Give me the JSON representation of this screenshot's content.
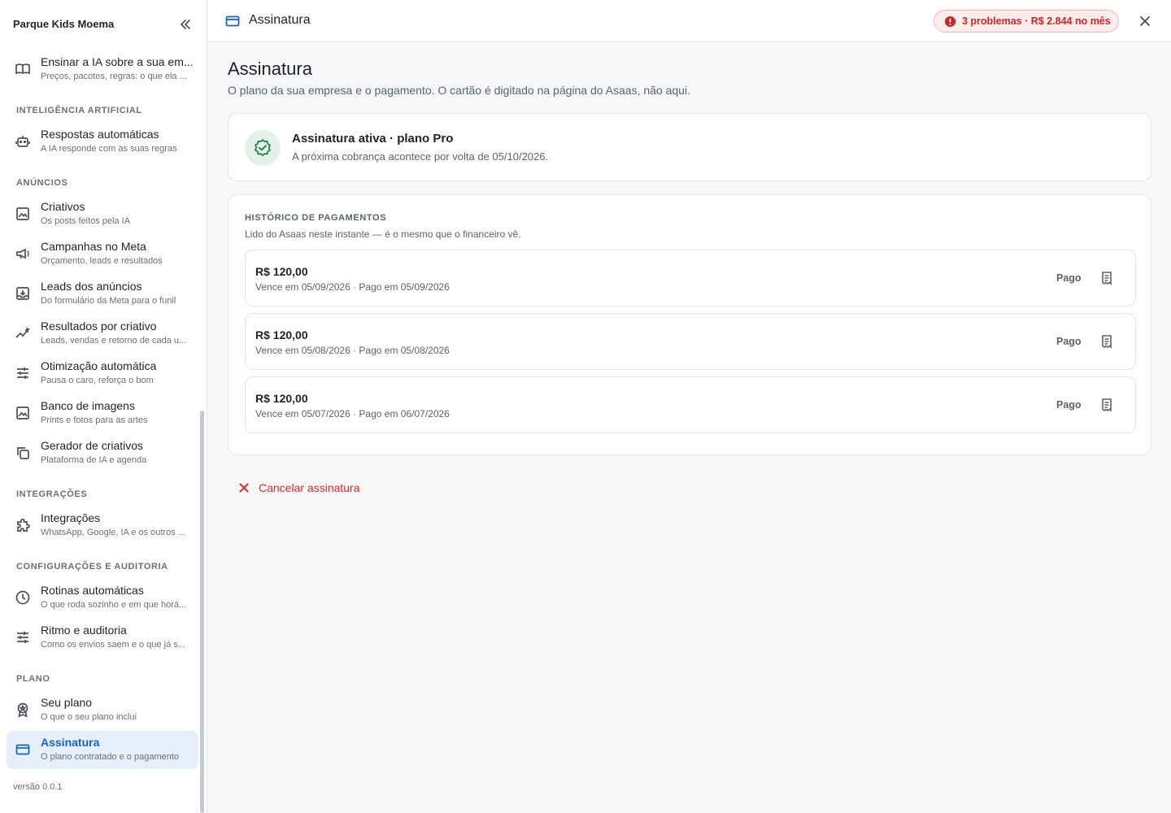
{
  "sidebar": {
    "company": "Parque Kids Moema",
    "top_item": {
      "label": "Ensinar a IA sobre a sua em...",
      "sub": "Preços, pacotes, regras: o que ela ..."
    },
    "sections": {
      "ai": "INTELIGÊNCIA ARTIFICIAL",
      "ads": "ANÚNCIOS",
      "integrations": "INTEGRAÇÕES",
      "config": "CONFIGURAÇÕES E AUDITORIA",
      "plan": "PLANO"
    },
    "items": {
      "auto_replies": {
        "label": "Respostas automáticas",
        "sub": "A IA responde com as suas regras"
      },
      "creatives": {
        "label": "Criativos",
        "sub": "Os posts feitos pela IA"
      },
      "meta_campaigns": {
        "label": "Campanhas no Meta",
        "sub": "Orçamento, leads e resultados"
      },
      "ad_leads": {
        "label": "Leads dos anúncios",
        "sub": "Do formulário da Meta para o funil"
      },
      "results": {
        "label": "Resultados por criativo",
        "sub": "Leads, vendas e retorno de cada u..."
      },
      "optimization": {
        "label": "Otimização automática",
        "sub": "Pausa o caro, reforça o bom"
      },
      "image_bank": {
        "label": "Banco de imagens",
        "sub": "Prints e fotos para as artes"
      },
      "generator": {
        "label": "Gerador de criativos",
        "sub": "Plataforma de IA e agenda"
      },
      "integrations": {
        "label": "Integrações",
        "sub": "WhatsApp, Google, IA e os outros ..."
      },
      "routines": {
        "label": "Rotinas automáticas",
        "sub": "O que roda sozinho e em que horá..."
      },
      "rhythm": {
        "label": "Ritmo e auditoria",
        "sub": "Como os envios saem e o que já s..."
      },
      "your_plan": {
        "label": "Seu plano",
        "sub": "O que o seu plano inclui"
      },
      "subscription": {
        "label": "Assinatura",
        "sub": "O plano contratado e o pagamento"
      }
    },
    "version": "versão 0.0.1"
  },
  "topbar": {
    "title": "Assinatura",
    "badge": "3 problemas · R$ 2.844 no mês"
  },
  "main": {
    "title": "Assinatura",
    "subtitle": "O plano da sua empresa e o pagamento. O cartão é digitado na página do Asaas, não aqui.",
    "status": {
      "title": "Assinatura ativa · plano Pro",
      "desc": "A próxima cobrança acontece por volta de 05/10/2026."
    },
    "history": {
      "heading": "HISTÓRICO DE PAGAMENTOS",
      "sub": "Lido do Asaas neste instante — é o mesmo que o financeiro vê.",
      "payments": [
        {
          "amount": "R$ 120,00",
          "dates": "Vence em 05/09/2026 · Pago em 05/09/2026",
          "status": "Pago"
        },
        {
          "amount": "R$ 120,00",
          "dates": "Vence em 05/08/2026 · Pago em 05/08/2026",
          "status": "Pago"
        },
        {
          "amount": "R$ 120,00",
          "dates": "Vence em 05/07/2026 · Pago em 06/07/2026",
          "status": "Pago"
        }
      ]
    },
    "cancel_label": "Cancelar assinatura"
  },
  "colors": {
    "accent": "#1565c0",
    "danger": "#d32f2f",
    "success": "#1e7d45",
    "active_bg": "#e6f0fb"
  }
}
